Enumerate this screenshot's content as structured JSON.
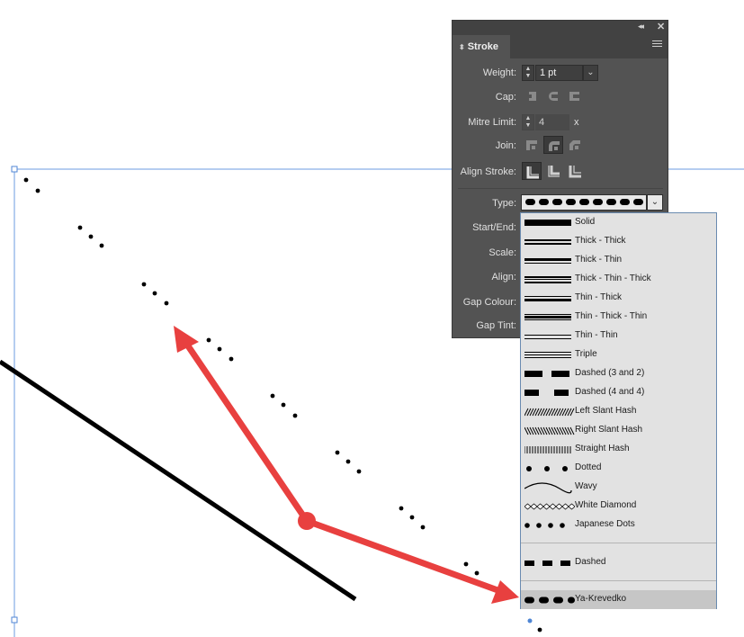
{
  "panel": {
    "tab_title": "Stroke",
    "labels": {
      "weight": "Weight:",
      "cap": "Cap:",
      "mitre_limit": "Mitre Limit:",
      "join": "Join:",
      "align_stroke": "Align Stroke:",
      "type": "Type:",
      "start_end": "Start/End:",
      "scale": "Scale:",
      "align": "Align:",
      "gap_colour": "Gap Colour:",
      "gap_tint": "Gap Tint:"
    },
    "weight_value": "1 pt",
    "mitre_value": "4",
    "mitre_unit": "x",
    "icons": {
      "collapse": "double-chevron-left-icon",
      "close": "close-icon",
      "menu": "panel-menu-icon",
      "cap": [
        "butt-cap-icon",
        "round-cap-icon",
        "projecting-cap-icon"
      ],
      "join": [
        "miter-join-icon",
        "round-join-icon",
        "bevel-join-icon"
      ],
      "align": [
        "align-center-icon",
        "align-inside-icon",
        "align-outside-icon"
      ]
    }
  },
  "stroke_types": {
    "selected": "Ya-Krevedko",
    "options": [
      "Solid",
      "Thick - Thick",
      "Thick - Thin",
      "Thick - Thin - Thick",
      "Thin - Thick",
      "Thin - Thick - Thin",
      "Thin - Thin",
      "Triple",
      "Dashed (3 and 2)",
      "Dashed (4 and 4)",
      "Left Slant Hash",
      "Right Slant Hash",
      "Straight Hash",
      "Dotted",
      "Wavy",
      "White Diamond",
      "Japanese Dots"
    ],
    "custom": [
      "Dashed"
    ],
    "user": [
      "Ya-Krevedko"
    ]
  },
  "colors": {
    "panel_bg": "#535353",
    "dropdown_bg": "#e2e2e2",
    "selection_bg": "#c6c6c6",
    "arrow": "#f04848",
    "guide": "#5b8fd6"
  }
}
